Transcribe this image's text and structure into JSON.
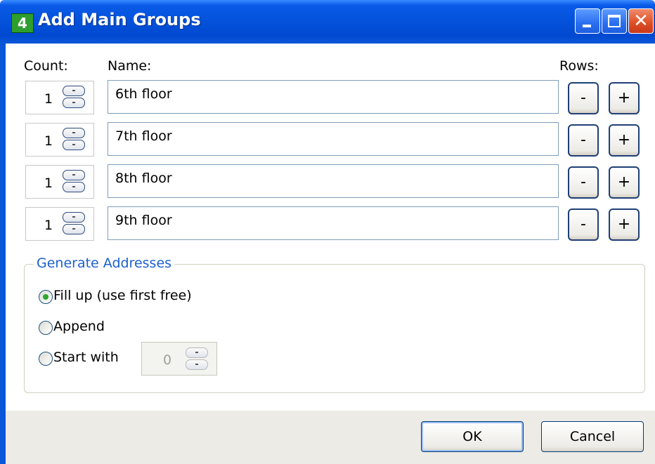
{
  "window": {
    "icon_text": "4",
    "title": "Add Main Groups"
  },
  "headers": {
    "count": "Count:",
    "name": "Name:",
    "rows": "Rows:"
  },
  "groups": [
    {
      "count": "1",
      "name": "6th floor"
    },
    {
      "count": "1",
      "name": "7th floor"
    },
    {
      "count": "1",
      "name": "8th floor"
    },
    {
      "count": "1",
      "name": "9th floor"
    }
  ],
  "row_buttons": {
    "minus": "-",
    "plus": "+"
  },
  "generate": {
    "legend": "Generate Addresses",
    "options": [
      "Fill up (use first free)",
      "Append",
      "Start with"
    ],
    "selected": "Fill up (use first free)",
    "start_with_value": "0"
  },
  "footer": {
    "ok": "OK",
    "cancel": "Cancel"
  },
  "colors": {
    "titlebar": "#0453dc",
    "legend_text": "#1b5fd0",
    "footer_bg": "#ecebe6",
    "radio_dot": "#2ea62e"
  }
}
